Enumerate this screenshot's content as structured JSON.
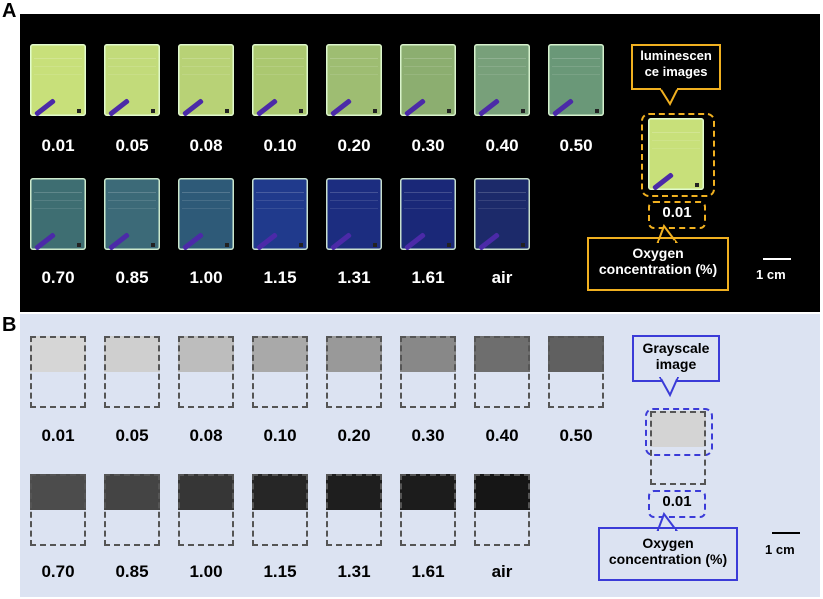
{
  "panels": {
    "a": {
      "letter": "A",
      "concentrations_row1": [
        "0.01",
        "0.05",
        "0.08",
        "0.10",
        "0.20",
        "0.30",
        "0.40",
        "0.50"
      ],
      "concentrations_row2": [
        "0.70",
        "0.85",
        "1.00",
        "1.15",
        "1.31",
        "1.61",
        "air"
      ],
      "tile_colors_row1": [
        "#c8e07a",
        "#c2db7a",
        "#b8d276",
        "#abc870",
        "#9ebd72",
        "#8cae70",
        "#78a07a",
        "#6a9878"
      ],
      "tile_colors_row2": [
        "#3e6e72",
        "#3c6a78",
        "#2e5a78",
        "#203a8c",
        "#1c2d80",
        "#1a2878",
        "#1c2a6a"
      ],
      "callout_top": "luminescen ce images",
      "sample_label": "0.01",
      "callout_bottom": "Oxygen concentration (%)",
      "scale": "1 cm",
      "accent_color": "#f0b020"
    },
    "b": {
      "letter": "B",
      "concentrations_row1": [
        "0.01",
        "0.05",
        "0.08",
        "0.10",
        "0.20",
        "0.30",
        "0.40",
        "0.50"
      ],
      "concentrations_row2": [
        "0.70",
        "0.85",
        "1.00",
        "1.15",
        "1.31",
        "1.61",
        "air"
      ],
      "gray_row1": [
        "#d6d6d6",
        "#cfcfcf",
        "#bdbdbd",
        "#a9a9a9",
        "#999999",
        "#888888",
        "#6e6e6e",
        "#606060"
      ],
      "gray_row2": [
        "#4c4c4c",
        "#444444",
        "#363636",
        "#262626",
        "#1e1e1e",
        "#1c1c1c",
        "#161616"
      ],
      "callout_top": "Grayscale image",
      "sample_label": "0.01",
      "callout_bottom": "Oxygen concentration (%)",
      "scale": "1 cm",
      "accent_color": "#3b3bd8"
    }
  }
}
